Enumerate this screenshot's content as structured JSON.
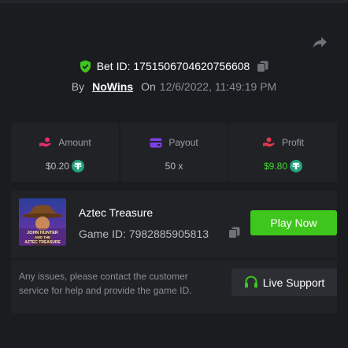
{
  "bet": {
    "label": "Bet ID: 1751506704620756608",
    "by_label": "By",
    "user": "NoWins",
    "on_label": "On",
    "date": "12/6/2022, 11:49:19 PM"
  },
  "stats": {
    "amount": {
      "label": "Amount",
      "value": "$0.20",
      "icon": "coins-hand-icon"
    },
    "payout": {
      "label": "Payout",
      "value": "50 x",
      "icon": "wallet-icon"
    },
    "profit": {
      "label": "Profit",
      "value": "$9.80",
      "icon": "money-hand-icon"
    }
  },
  "game": {
    "title": "Aztec Treasure",
    "id_label": "Game ID: 7982885905813",
    "play_label": "Play Now",
    "thumb_text": "JOHN HUNTER AND THE AZTEC TREASURE"
  },
  "support": {
    "message": "Any issues, please contact the customer service for help and provide the game ID.",
    "button_label": "Live Support"
  },
  "colors": {
    "background": "#1a1c20",
    "panel": "#202226",
    "accent_green": "#3fc61d",
    "profit_green": "#3ddc2a",
    "tether_teal": "#26a17b"
  }
}
